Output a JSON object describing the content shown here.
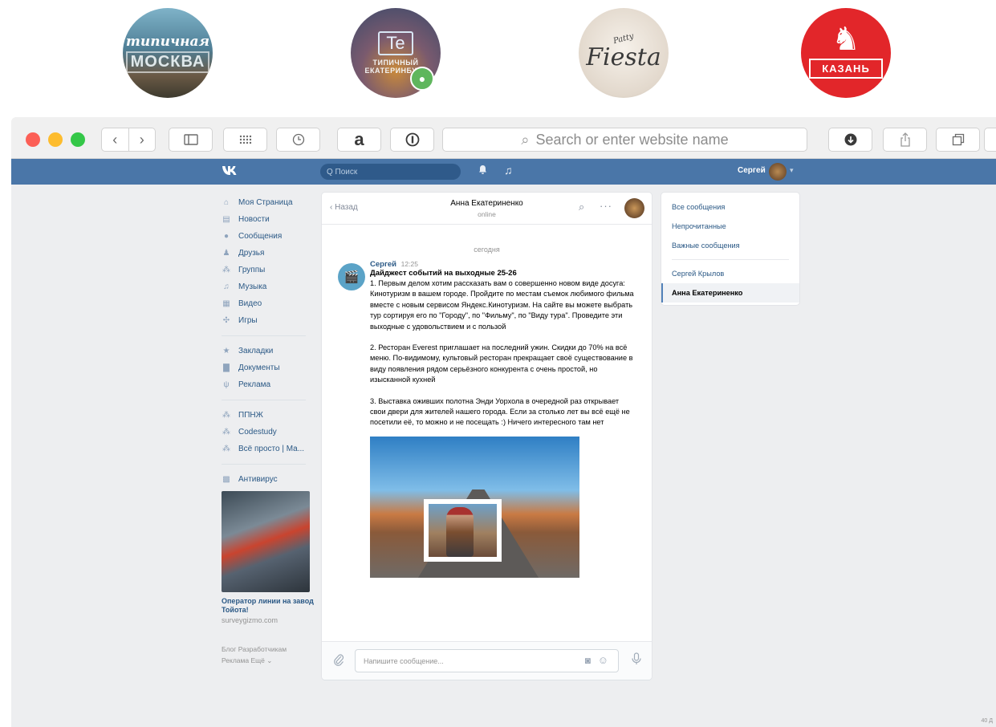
{
  "logos": {
    "moscow": {
      "line1": "типичная",
      "line2": "МОСКВА"
    },
    "ekb": {
      "badge": "Te",
      "line1": "ТИПИЧНЫЙ",
      "line2": "ЕКАТЕРИНБУРГ"
    },
    "fiesta": {
      "line1": "Patty",
      "line2": "Fiesta"
    },
    "kazan": {
      "label": "КАЗАНЬ"
    }
  },
  "browser": {
    "address_placeholder": "Search or enter website name",
    "amazon_label": "a"
  },
  "vk_header": {
    "logo": "VK",
    "search_placeholder": "Q Поиск",
    "user_name": "Сергей"
  },
  "left_menu": {
    "items": [
      {
        "label": "Моя Страница",
        "icon": "home-icon"
      },
      {
        "label": "Новости",
        "icon": "news-icon"
      },
      {
        "label": "Сообщения",
        "icon": "messages-icon"
      },
      {
        "label": "Друзья",
        "icon": "friends-icon"
      },
      {
        "label": "Группы",
        "icon": "groups-icon"
      },
      {
        "label": "Музыка",
        "icon": "music-icon"
      },
      {
        "label": "Видео",
        "icon": "video-icon"
      },
      {
        "label": "Игры",
        "icon": "games-icon"
      }
    ],
    "items2": [
      {
        "label": "Закладки",
        "icon": "star-icon"
      },
      {
        "label": "Документы",
        "icon": "document-icon"
      },
      {
        "label": "Реклама",
        "icon": "ads-icon"
      }
    ],
    "items3": [
      {
        "label": "ППНЖ",
        "icon": "group-icon"
      },
      {
        "label": "Codestudy",
        "icon": "group-icon"
      },
      {
        "label": "Всё просто | Ма...",
        "icon": "group-icon"
      }
    ],
    "items4": [
      {
        "label": "Антивирус",
        "icon": "apps-icon"
      }
    ],
    "ad": {
      "title": "Оператор линии на завод Тойота!",
      "source": "surveygizmo.com"
    },
    "footer": {
      "line1": "Блог   Разработчикам",
      "line2": "Реклама   Ещё ⌄"
    }
  },
  "chat": {
    "back_label": "Назад",
    "contact_name": "Анна Екатериненко",
    "contact_status": "online",
    "date_divider": "сегодня",
    "message": {
      "author": "Сергей",
      "time": "12:25",
      "title": "Дайджест событий на выходные 25-26",
      "paragraphs": [
        "1. Первым делом хотим рассказать вам о совершенно новом виде досуга: Кинотуризм в вашем городе. Пройдите по местам съемок любимого фильма вместе с новым сервисом Яндекс.Кинотуризм. На сайте вы можете выбрать тур сортируя его по \"Городу\", по \"Фильму\", по \"Виду тура\". Проведите эти выходные с удовольствием и с пользой",
        "2. Ресторан Everest приглашает на последний ужин. Скидки до 70% на всё меню. По-видимому, культовый ресторан прекращает своё существование в виду появления рядом серьёзного конкурента с очень простой, но изысканной кухней",
        "3. Выставка оживших полотна Энди Уорхола в очередной раз открывает свои двери для жителей нашего города. Если за столько лет вы всё ещё не посетили её, то можно и не посещать :) Ничего интересного там нет"
      ]
    },
    "compose_placeholder": "Напишите сообщение..."
  },
  "right_panel": {
    "items": [
      "Все сообщения",
      "Непрочитанные",
      "Важные сообщения"
    ],
    "conversations": [
      "Сергей Крылов",
      "Анна Екатериненко"
    ]
  },
  "corner_text": "40 Д"
}
